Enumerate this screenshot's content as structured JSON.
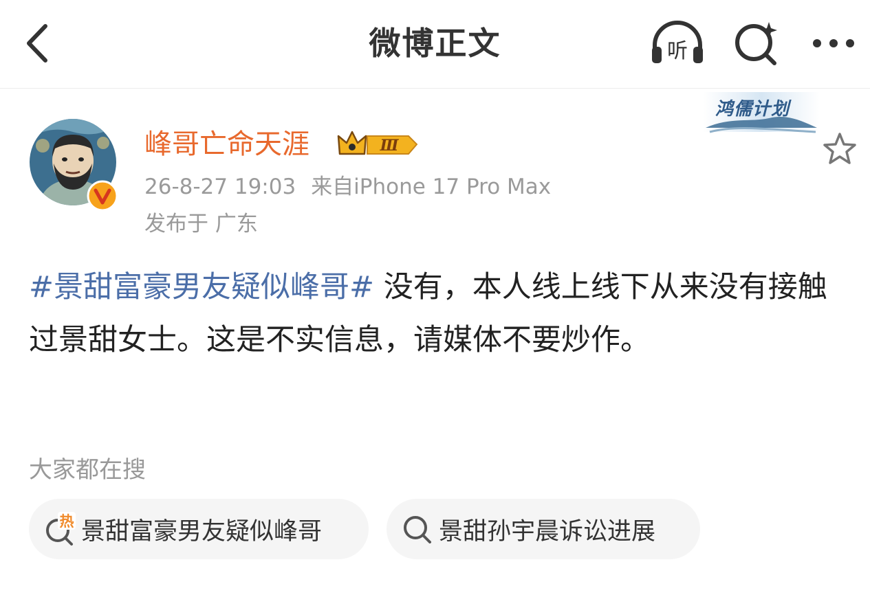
{
  "header": {
    "title": "微博正文",
    "listen_label": "听"
  },
  "badge": {
    "text": "鸿儒计划"
  },
  "post": {
    "author": "峰哥亡命天涯",
    "vip_level": "Ⅲ",
    "timestamp": "26-8-27 19:03",
    "source": "来自iPhone 17 Pro Max",
    "location": "发布于 广东",
    "hashtag": "#景甜富豪男友疑似峰哥#",
    "body": " 没有，本人线上线下从来没有接触过景甜女士。这是不实信息，请媒体不要炒作。"
  },
  "search": {
    "title": "大家都在搜",
    "hot_marker": "热",
    "items": [
      {
        "label": "景甜富豪男友疑似峰哥",
        "icon": "hot-search-icon"
      },
      {
        "label": "景甜孙宇晨诉讼进展",
        "icon": "search-icon"
      }
    ]
  },
  "colors": {
    "username": "#e8692d",
    "hashtag": "#4b6ea8",
    "meta": "#9a9a9a",
    "hot": "#f08a2a"
  }
}
